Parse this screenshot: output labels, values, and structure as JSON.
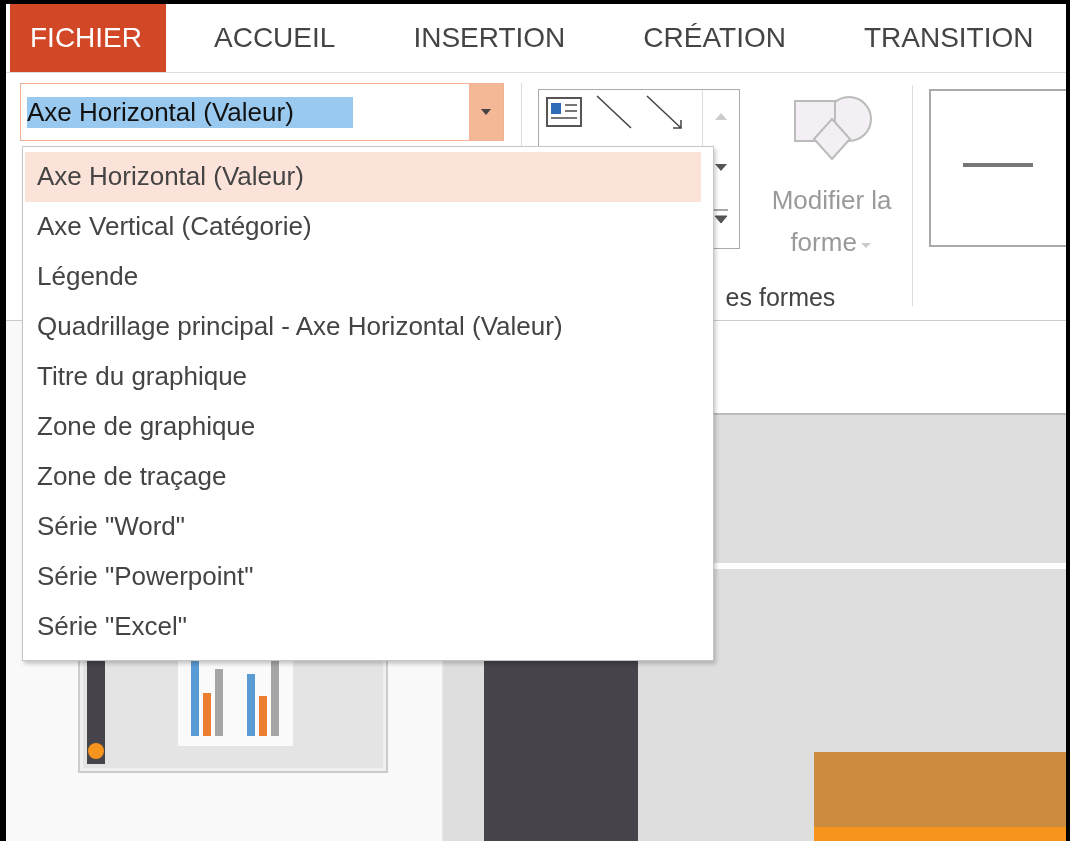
{
  "tabs": [
    {
      "label": "FICHIER",
      "kind": "file"
    },
    {
      "label": "ACCUEIL",
      "kind": "tab"
    },
    {
      "label": "INSERTION",
      "kind": "tab"
    },
    {
      "label": "CRÉATION",
      "kind": "tab"
    },
    {
      "label": "TRANSITION",
      "kind": "tab"
    }
  ],
  "element_selector": {
    "value": "Axe Horizontal (Valeur)",
    "expanded": true,
    "options": [
      {
        "label": "Axe Horizontal (Valeur)",
        "selected": true
      },
      {
        "label": "Axe Vertical (Catégorie)",
        "selected": false
      },
      {
        "label": "Légende",
        "selected": false
      },
      {
        "label": "Quadrillage principal - Axe Horizontal (Valeur)",
        "selected": false
      },
      {
        "label": "Titre du graphique",
        "selected": false
      },
      {
        "label": "Zone de graphique",
        "selected": false
      },
      {
        "label": "Zone de traçage",
        "selected": false
      },
      {
        "label": "Série \"Word\"",
        "selected": false
      },
      {
        "label": "Série \"Powerpoint\"",
        "selected": false
      },
      {
        "label": "Série \"Excel\"",
        "selected": false
      }
    ]
  },
  "edit_shape_button": {
    "label": "Modifier la forme",
    "disabled": true
  },
  "group_label": "es formes"
}
